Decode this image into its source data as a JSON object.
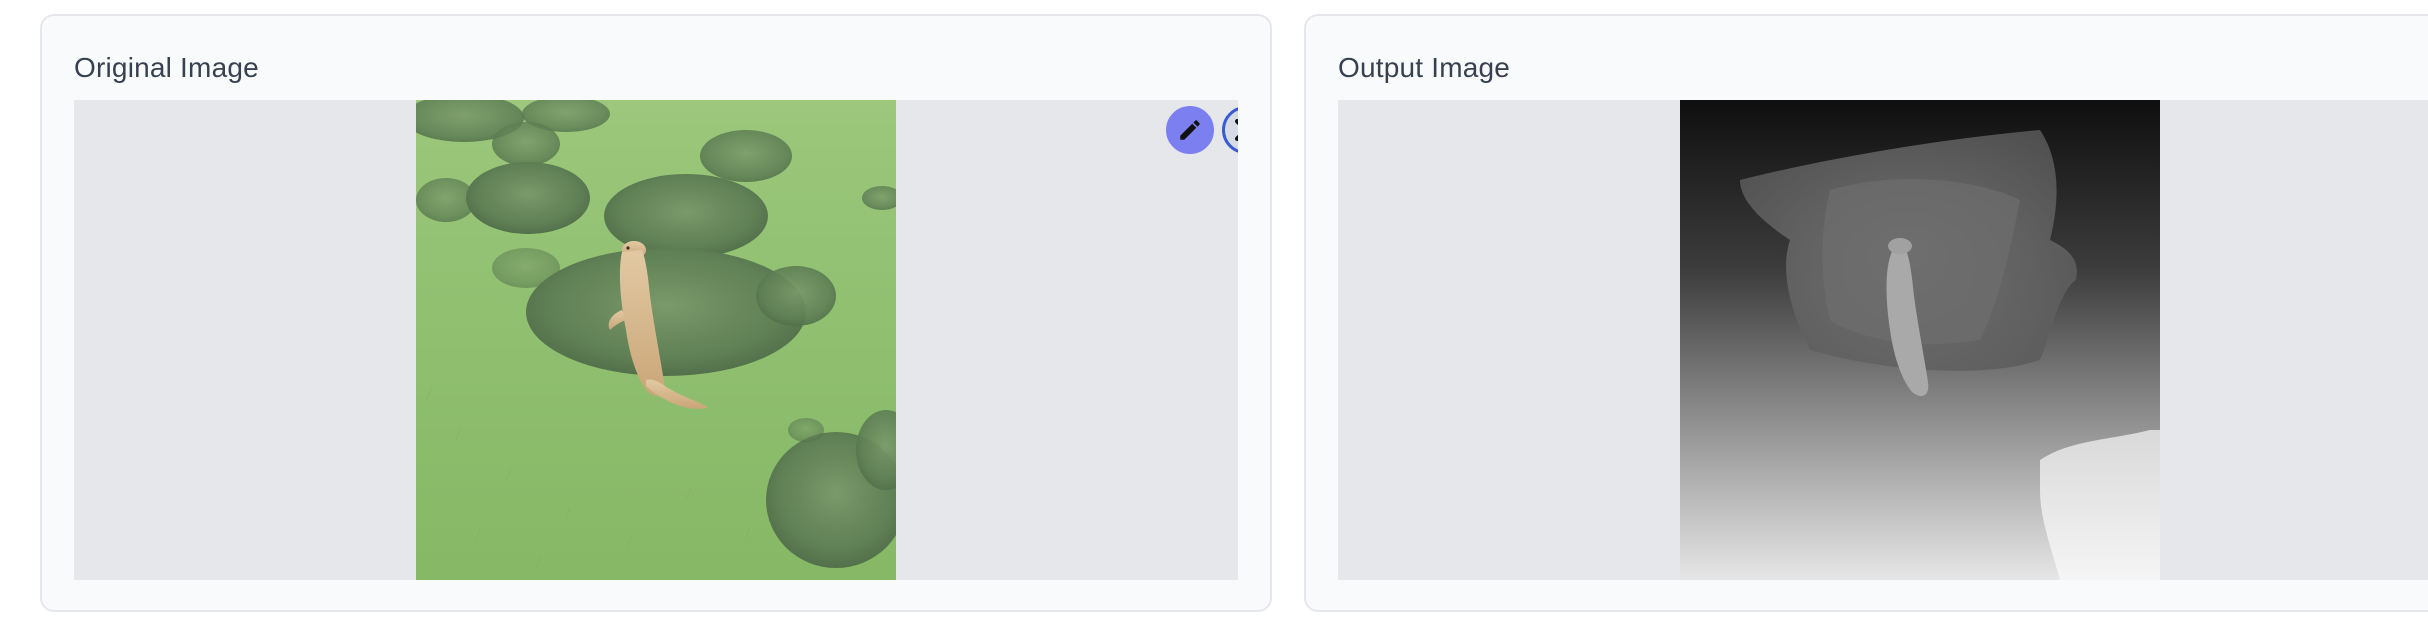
{
  "panels": {
    "original": {
      "title": "Original Image"
    },
    "output": {
      "title": "Output Image"
    }
  },
  "toolbar": {
    "edit_icon": "pencil-icon",
    "close_icon": "close-icon"
  },
  "colors": {
    "accent": "#7c7ff0",
    "close_ring": "#3b5bd6",
    "image_placeholder": "#e5e7eb",
    "panel_bg": "#f9fafb",
    "panel_border": "#e5e7eb"
  }
}
